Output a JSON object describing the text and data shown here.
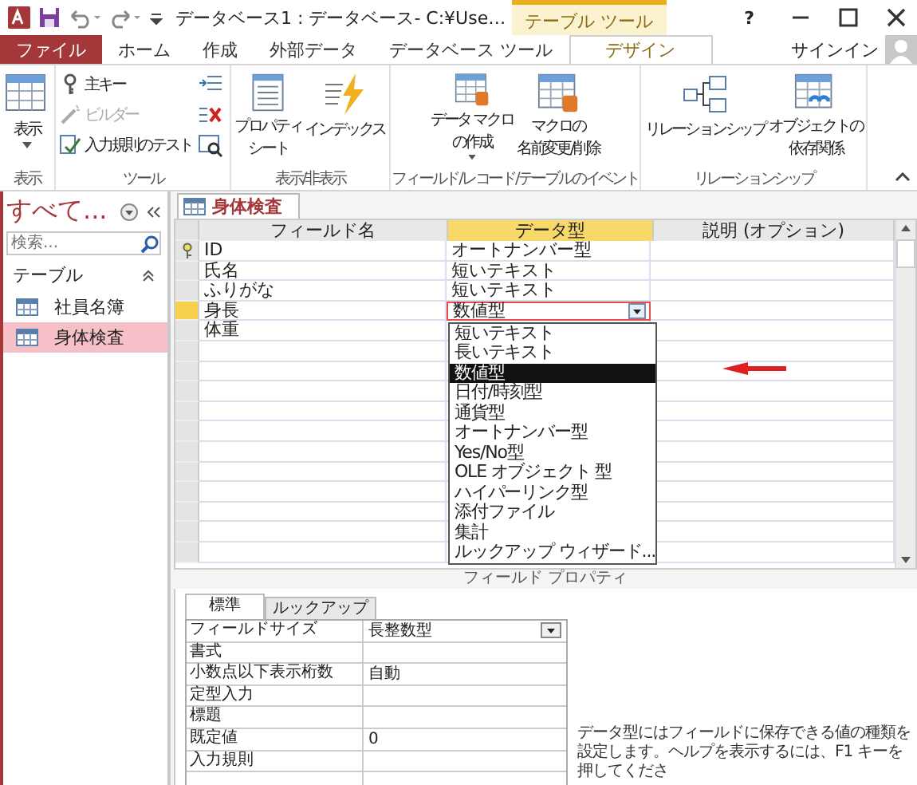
{
  "title_bar": {
    "title": "データベース1 : データベース- C:¥Use…",
    "context_tab": "テーブル ツール",
    "help": "?"
  },
  "ribbon_tabs": [
    {
      "label": "ファイル",
      "kind": "file",
      "selected": false
    },
    {
      "label": "ホーム",
      "kind": "normal",
      "selected": false
    },
    {
      "label": "作成",
      "kind": "normal",
      "selected": false
    },
    {
      "label": "外部データ",
      "kind": "normal",
      "selected": false
    },
    {
      "label": "データベース ツール",
      "kind": "normal",
      "selected": false
    },
    {
      "label": "デザイン",
      "kind": "context",
      "selected": true
    }
  ],
  "sign_in": "サインイン",
  "ribbon_groups": [
    {
      "label": "表示",
      "buttons": [
        {
          "kind": "large",
          "lines": [
            "表示"
          ],
          "menu": true
        }
      ]
    },
    {
      "label": "ツール",
      "buttons": [
        {
          "kind": "small",
          "label": "主キー",
          "disabled": false
        },
        {
          "kind": "small",
          "label": "ビルダー",
          "disabled": true
        },
        {
          "kind": "small",
          "label": "入力規則のテスト",
          "disabled": false
        },
        {
          "kind": "icon"
        },
        {
          "kind": "icon"
        },
        {
          "kind": "icon"
        }
      ]
    },
    {
      "label": "表示/非表示",
      "buttons": [
        {
          "kind": "large",
          "lines": [
            "プロパティ",
            "シート"
          ],
          "menu": false
        },
        {
          "kind": "large",
          "lines": [
            "インデックス"
          ],
          "menu": false
        }
      ]
    },
    {
      "label": "フィールド/レコード/テーブルのイベント",
      "buttons": [
        {
          "kind": "large",
          "lines": [
            "データ マクロ",
            "の作成"
          ],
          "menu": true
        },
        {
          "kind": "large",
          "lines": [
            "マクロの",
            "名前変更/削除"
          ],
          "menu": false
        }
      ]
    },
    {
      "label": "リレーションシップ",
      "buttons": [
        {
          "kind": "large",
          "lines": [
            "リレーションシップ"
          ],
          "menu": false
        },
        {
          "kind": "large",
          "lines": [
            "オブジェクトの",
            "依存関係"
          ],
          "menu": false
        }
      ]
    }
  ],
  "nav_pane": {
    "title": "すべて...",
    "search": {
      "placeholder": "検索..."
    },
    "section": "テーブル",
    "items": [
      {
        "label": "社員名簿",
        "selected": false
      },
      {
        "label": "身体検査",
        "selected": true
      }
    ]
  },
  "document_tab": "身体検査",
  "columns": [
    {
      "label": "フィールド名",
      "selected": false
    },
    {
      "label": "データ型",
      "selected": true
    },
    {
      "label": "説明 (オプション)",
      "selected": false
    }
  ],
  "fields": [
    {
      "name": "ID",
      "type": "オートナンバー型",
      "primary_key": true,
      "current": false
    },
    {
      "name": "氏名",
      "type": "短いテキスト",
      "primary_key": false,
      "current": false
    },
    {
      "name": "ふりがな",
      "type": "短いテキスト",
      "primary_key": false,
      "current": false
    },
    {
      "name": "身長",
      "type": "数値型",
      "primary_key": false,
      "current": true
    },
    {
      "name": "体重",
      "primary_key": false,
      "current": false
    }
  ],
  "type_dropdown": [
    {
      "label": "短いテキスト",
      "selected": false
    },
    {
      "label": "長いテキスト",
      "selected": false
    },
    {
      "label": "数値型",
      "selected": true
    },
    {
      "label": "日付/時刻型",
      "selected": false
    },
    {
      "label": "通貨型",
      "selected": false
    },
    {
      "label": "オートナンバー型",
      "selected": false
    },
    {
      "label": "Yes/No型",
      "selected": false
    },
    {
      "label": "OLE オブジェクト 型",
      "selected": false
    },
    {
      "label": "ハイパーリンク型",
      "selected": false
    },
    {
      "label": "添付ファイル",
      "selected": false
    },
    {
      "label": "集計",
      "selected": false
    },
    {
      "label": "ルックアップ ウィザード...",
      "selected": false
    }
  ],
  "properties_label": "フィールド プロパティ",
  "property_tabs": [
    {
      "label": "標準",
      "selected": true
    },
    {
      "label": "ルックアップ",
      "selected": false
    }
  ],
  "properties": [
    {
      "label": "フィールドサイズ",
      "value": "長整数型",
      "dropdown": true
    },
    {
      "label": "書式",
      "dropdown": false
    },
    {
      "label": "小数点以下表示桁数",
      "value": "自動",
      "dropdown": false
    },
    {
      "label": "定型入力",
      "dropdown": false
    },
    {
      "label": "標題",
      "dropdown": false
    },
    {
      "label": "既定値",
      "value": "0",
      "dropdown": false
    },
    {
      "label": "入力規則",
      "dropdown": false
    }
  ],
  "help_text": "データ型にはフィールドに保存できる値の種類を設定します。ヘルプを表示するには、F1 キーを押してくださ"
}
